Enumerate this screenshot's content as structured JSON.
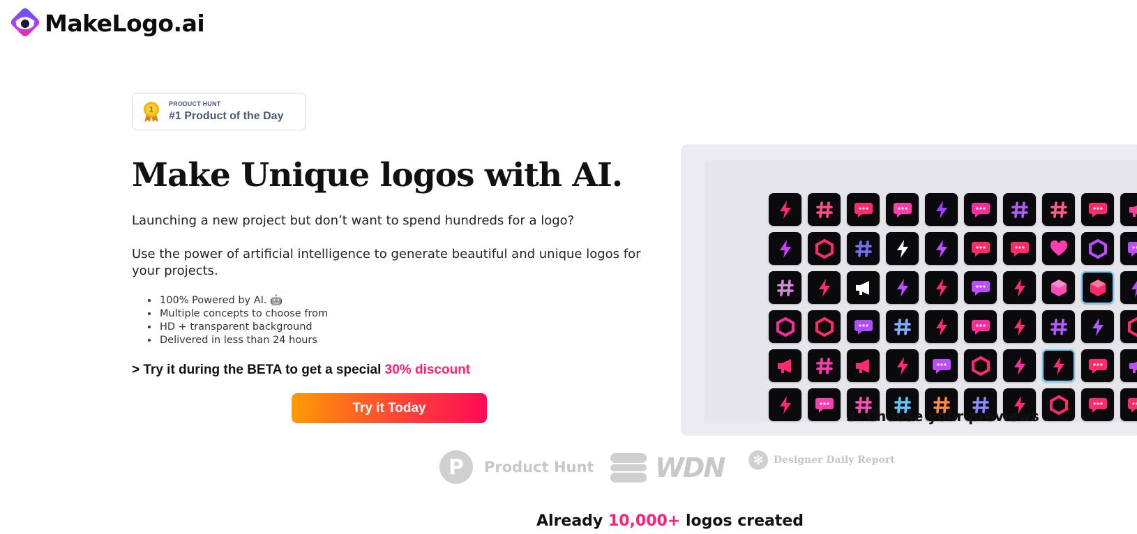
{
  "brand": {
    "name": "MakeLogo.ai"
  },
  "badge": {
    "kicker": "PRODUCT HUNT",
    "title": "#1 Product of the Day",
    "medal_number": "1"
  },
  "hero": {
    "headline": "Make Unique logos with AI.",
    "paragraph1": "Launching a new project but don’t want to spend hundreds for a logo?",
    "paragraph2": "Use the power of artificial intelligence to generate beautiful and unique logos for your projects.",
    "features": [
      "100% Powered by AI. 🤖",
      "Multiple concepts to choose from",
      "HD + transparent background",
      "Delivered in less than 24 hours"
    ],
    "beta_prefix": "> Try it during the BETA to get a special ",
    "beta_accent": "30% discount",
    "cta_label": "Try it Today"
  },
  "preview": {
    "caption": "3. Choose your previews",
    "tiles": [
      {
        "icon": "bolt-icon",
        "color": "#ff2a6d"
      },
      {
        "icon": "hash-icon",
        "color": "#ff4d8d"
      },
      {
        "icon": "chat-icon",
        "color": "#ff2a6d"
      },
      {
        "icon": "chat-icon",
        "color": "#ff3da8"
      },
      {
        "icon": "bolt-icon",
        "color": "#a43bff"
      },
      {
        "icon": "chat-icon",
        "color": "#ff2a9d"
      },
      {
        "icon": "hash-icon",
        "color": "#b25bff"
      },
      {
        "icon": "hash-icon",
        "color": "#ff5a8a"
      },
      {
        "icon": "chat-icon",
        "color": "#ff2a6d"
      },
      {
        "icon": "megaphone-icon",
        "color": "#ff3d9a"
      },
      {
        "icon": "bolt-icon",
        "color": "#d63cff"
      },
      {
        "icon": "hex-icon",
        "color": "#ff2a6d"
      },
      {
        "icon": "hash-icon",
        "color": "#7b6cff"
      },
      {
        "icon": "bolt-icon",
        "color": "#ffffff"
      },
      {
        "icon": "bolt-icon",
        "color": "#c04bff"
      },
      {
        "icon": "chat-icon",
        "color": "#ff2a6d"
      },
      {
        "icon": "chat-icon",
        "color": "#ff2a6d"
      },
      {
        "icon": "heart-icon",
        "color": "#ff3db0"
      },
      {
        "icon": "hex-icon",
        "color": "#c04bff"
      },
      {
        "icon": "chat-icon",
        "color": "#c04bff"
      },
      {
        "icon": "hash-icon",
        "color": "#d28ad7"
      },
      {
        "icon": "bolt-icon",
        "color": "#ff2a6d"
      },
      {
        "icon": "megaphone-icon",
        "color": "#ffffff"
      },
      {
        "icon": "bolt-icon",
        "color": "#c04bff"
      },
      {
        "icon": "bolt-icon",
        "color": "#ff2a6d"
      },
      {
        "icon": "chat-icon",
        "color": "#c04bff"
      },
      {
        "icon": "bolt-icon",
        "color": "#ff2a6d"
      },
      {
        "icon": "cube-icon",
        "color": "#ff4db5"
      },
      {
        "icon": "cube-icon",
        "color": "#ff2a6d"
      },
      {
        "icon": "bolt-icon",
        "color": "#c04bff"
      },
      {
        "icon": "hex-icon",
        "color": "#ff2a9d"
      },
      {
        "icon": "hex-icon",
        "color": "#ff2a6d"
      },
      {
        "icon": "chat-icon",
        "color": "#b04bff"
      },
      {
        "icon": "hash-icon",
        "color": "#7fb0ff"
      },
      {
        "icon": "bolt-icon",
        "color": "#ff2a6d"
      },
      {
        "icon": "chat-icon",
        "color": "#ff2a9d"
      },
      {
        "icon": "bolt-icon",
        "color": "#ff2a6d"
      },
      {
        "icon": "hash-icon",
        "color": "#b25bff"
      },
      {
        "icon": "bolt-icon",
        "color": "#b25bff"
      },
      {
        "icon": "hex-icon",
        "color": "#ff2a6d"
      },
      {
        "icon": "megaphone-icon",
        "color": "#ff2a6d"
      },
      {
        "icon": "hash-icon",
        "color": "#ff3db0"
      },
      {
        "icon": "megaphone-icon",
        "color": "#ff2a6d"
      },
      {
        "icon": "bolt-icon",
        "color": "#ff2a6d"
      },
      {
        "icon": "chat-icon",
        "color": "#c04bff"
      },
      {
        "icon": "hex-icon",
        "color": "#ff2a6d"
      },
      {
        "icon": "bolt-icon",
        "color": "#ff2a9d"
      },
      {
        "icon": "bolt-icon",
        "color": "#ff2a6d"
      },
      {
        "icon": "chat-icon",
        "color": "#ff2a6d"
      },
      {
        "icon": "megaphone-icon",
        "color": "#c04bff"
      },
      {
        "icon": "bolt-icon",
        "color": "#ff2a6d"
      },
      {
        "icon": "chat-icon",
        "color": "#ff3db0"
      },
      {
        "icon": "hash-icon",
        "color": "#ff4db5"
      },
      {
        "icon": "hash-icon",
        "color": "#5cc8ff"
      },
      {
        "icon": "hash-icon",
        "color": "#ff8a3d"
      },
      {
        "icon": "hash-icon",
        "color": "#8a8aff"
      },
      {
        "icon": "bolt-icon",
        "color": "#ff2a6d"
      },
      {
        "icon": "hex-icon",
        "color": "#ff2a6d"
      },
      {
        "icon": "chat-icon",
        "color": "#ff2a6d"
      },
      {
        "icon": "chat-icon",
        "color": "#ff2a6d"
      }
    ],
    "selected_indices": [
      28,
      47
    ]
  },
  "press": [
    {
      "name": "Product Hunt",
      "mark": "P"
    },
    {
      "name": "WDN"
    },
    {
      "name": "Designer Daily Report",
      "mark": "✻"
    }
  ],
  "stats": {
    "prefix": "Already ",
    "accent": "10,000+",
    "suffix": " logos created"
  },
  "colors": {
    "accent": "#ff1f7a",
    "cta_start": "#ff9a02",
    "cta_end": "#ff0a58",
    "tile_bg": "#0a0a0c"
  }
}
